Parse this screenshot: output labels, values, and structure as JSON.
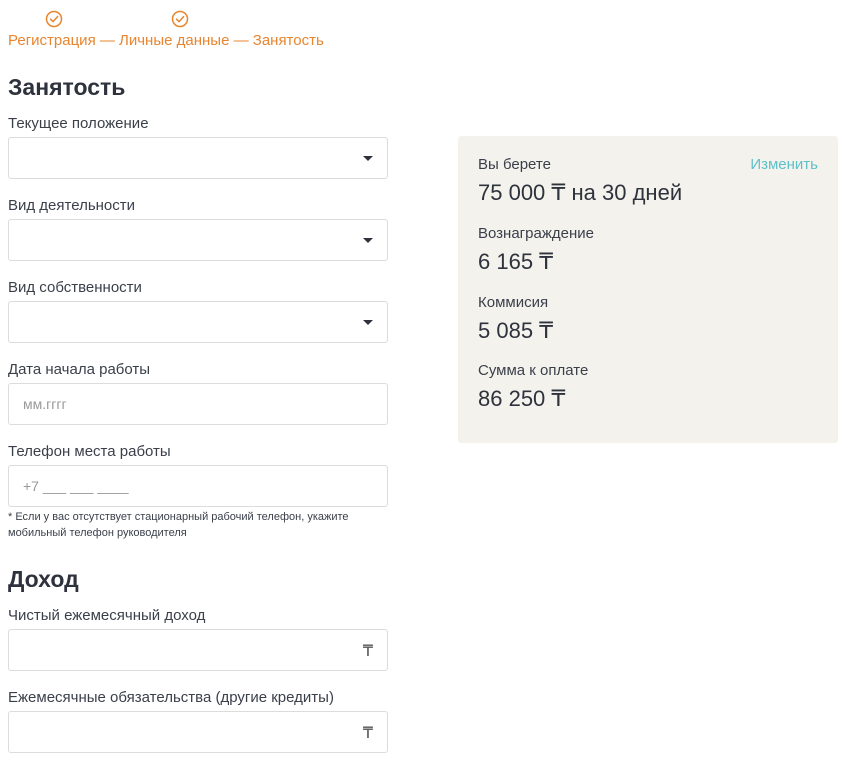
{
  "progress": {
    "steps_text": "Регистрация — Личные данные — Занятость",
    "completed_color": "#e8852f"
  },
  "employment": {
    "title": "Занятость",
    "current_position": {
      "label": "Текущее положение",
      "value": ""
    },
    "activity_type": {
      "label": "Вид деятельности",
      "value": ""
    },
    "ownership_type": {
      "label": "Вид собственности",
      "value": ""
    },
    "start_date": {
      "label": "Дата начала работы",
      "placeholder": "мм.гггг"
    },
    "work_phone": {
      "label": "Телефон места работы",
      "placeholder": "+7 ___ ___ ____"
    },
    "phone_note": "* Если у вас отсутствует стационарный рабочий телефон, укажите мобильный телефон руководителя"
  },
  "income": {
    "title": "Доход",
    "net_monthly": {
      "label": "Чистый ежемесячный доход",
      "currency": "₸"
    },
    "obligations": {
      "label": "Ежемесячные обязательства (другие кредиты)",
      "currency": "₸"
    }
  },
  "summary": {
    "borrow_label": "Вы берете",
    "borrow_value": "75 000 ₸ на 30 дней",
    "change_label": "Изменить",
    "reward_label": "Вознаграждение",
    "reward_value": "6 165 ₸",
    "commission_label": "Коммисия",
    "commission_value": "5 085 ₸",
    "total_label": "Сумма к оплате",
    "total_value": "86 250 ₸",
    "background": "#f4f2ed",
    "link_color": "#5ec0c9"
  }
}
